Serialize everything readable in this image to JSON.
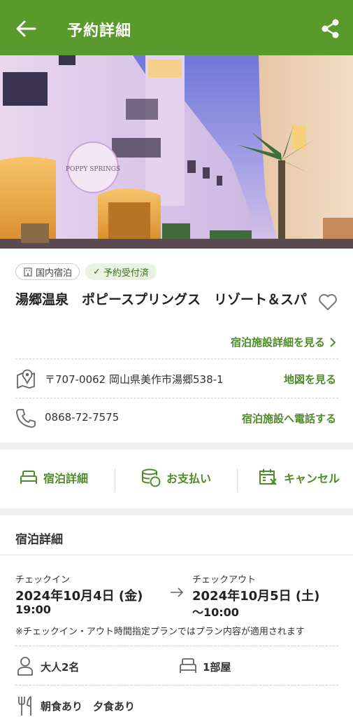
{
  "appbar": {
    "title": "予約詳細"
  },
  "hero": {
    "sign_text": "POPPY SPRINGS"
  },
  "badges": {
    "domestic": "国内宿泊",
    "confirmed": "予約受付済"
  },
  "hotel": {
    "name": "湯郷温泉　ポピースプリングス　リゾート＆スパ",
    "detail_link": "宿泊施設詳細を見る",
    "address": "〒707-0062 岡山県美作市湯郷538-1",
    "map_link": "地図を見る",
    "phone": "0868-72-7575",
    "call_link": "宿泊施設へ電話する"
  },
  "tabs": {
    "stay": "宿泊詳細",
    "payment": "お支払い",
    "cancel": "キャンセル"
  },
  "stay_details": {
    "title": "宿泊詳細",
    "checkin_label": "チェックイン",
    "checkin_date": "2024年10月4日 (金)",
    "checkin_time": "19:00",
    "checkout_label": "チェックアウト",
    "checkout_date": "2024年10月5日 (土)",
    "checkout_time": "〜10:00",
    "note": "※チェックイン・アウト時間指定プランではプラン内容が適用されます",
    "guests": "大人2名",
    "rooms": "1部屋",
    "meals": "朝食あり　夕食あり"
  },
  "colors": {
    "brand": "#5a9a2c",
    "link": "#4f8a2b"
  }
}
